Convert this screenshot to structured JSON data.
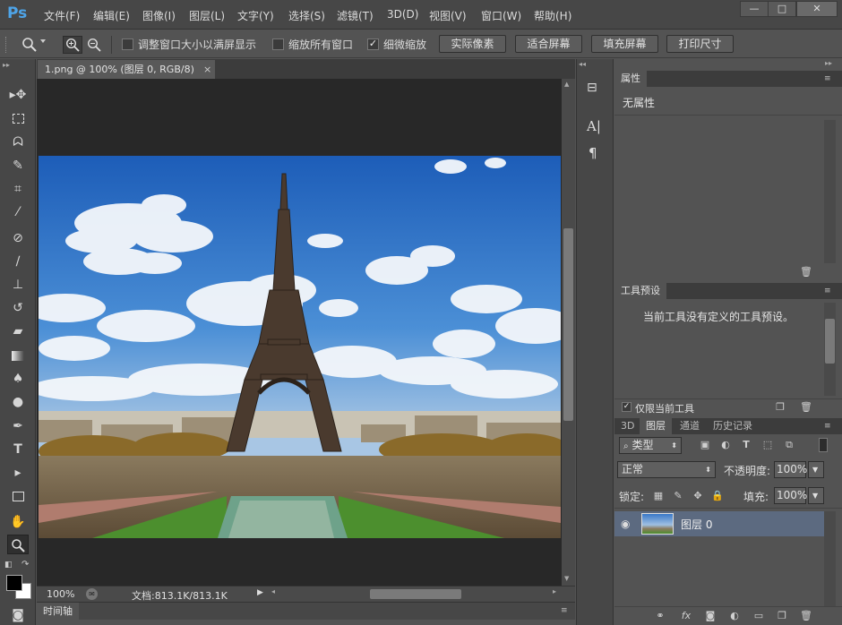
{
  "app": {
    "logo": "Ps",
    "menu": [
      "文件(F)",
      "编辑(E)",
      "图像(I)",
      "图层(L)",
      "文字(Y)",
      "选择(S)",
      "滤镜(T)",
      "3D(D)",
      "视图(V)",
      "窗口(W)",
      "帮助(H)"
    ],
    "window_buttons": [
      "—",
      "□",
      "✕"
    ]
  },
  "options": {
    "checks": [
      {
        "label": "调整窗口大小以满屏显示",
        "checked": false
      },
      {
        "label": "缩放所有窗口",
        "checked": false
      },
      {
        "label": "细微缩放",
        "checked": true
      }
    ],
    "buttons": [
      "实际像素",
      "适合屏幕",
      "填充屏幕",
      "打印尺寸"
    ]
  },
  "document": {
    "tab_title": "1.png @ 100% (图层 0, RGB/8)",
    "tab_close": "×",
    "zoom": "100%",
    "doc_size": "文档:813.1K/813.1K"
  },
  "timeline": {
    "label": "时间轴"
  },
  "properties": {
    "title": "属性",
    "content": "无属性"
  },
  "tool_presets": {
    "title": "工具预设",
    "content": "当前工具没有定义的工具预设。",
    "only_current_label": "仅限当前工具"
  },
  "layers_panel": {
    "tabs": [
      "3D",
      "图层",
      "通道",
      "历史记录"
    ],
    "active_tab": "图层",
    "filter_kind": "类型",
    "blend_mode": "正常",
    "opacity_label": "不透明度:",
    "opacity_value": "100%",
    "lock_label": "锁定:",
    "fill_label": "填充:",
    "fill_value": "100%",
    "layers": [
      {
        "name": "图层 0",
        "visible": true,
        "selected": true
      }
    ]
  },
  "colors": {
    "menubar": "#474747",
    "panel": "#535353",
    "canvas_bg": "#282828",
    "selected_layer": "#5c6a80",
    "ps_blue": "#4ea4e8"
  }
}
